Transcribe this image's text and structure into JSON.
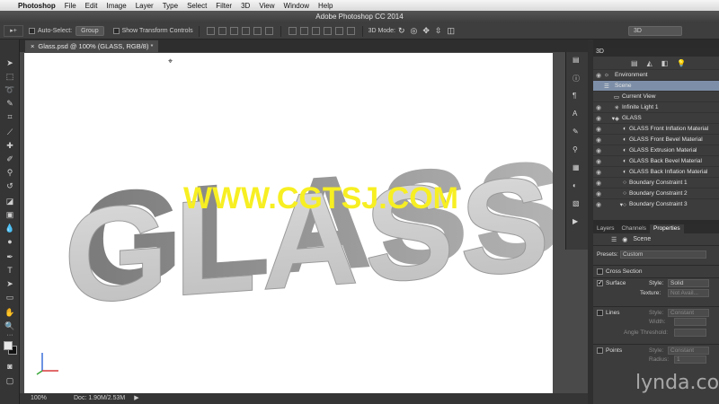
{
  "menubar": {
    "app_name": "Photoshop",
    "items": [
      "File",
      "Edit",
      "Image",
      "Layer",
      "Type",
      "Select",
      "Filter",
      "3D",
      "View",
      "Window",
      "Help"
    ]
  },
  "window_title": "Adobe Photoshop CC 2014",
  "options": {
    "auto_select_label": "Auto-Select:",
    "auto_select_value": "Group",
    "show_transform_label": "Show Transform Controls",
    "mode_label": "3D Mode:",
    "workspace_value": "3D"
  },
  "document": {
    "tab_title": "Glass.psd @ 100% (GLASS, RGB/8) *",
    "zoom": "100%",
    "doc_size": "Doc: 1.90M/2.53M",
    "scene_text": "GLASS"
  },
  "overlay_watermark": "WWW.CGTSJ.COM",
  "panel_3d": {
    "title": "3D",
    "rows": [
      {
        "label": "Environment",
        "icon": "environment-icon"
      },
      {
        "label": "Scene",
        "icon": "scene-icon"
      },
      {
        "label": "Current View",
        "icon": "camera-icon"
      },
      {
        "label": "Infinite Light 1",
        "icon": "light-icon"
      },
      {
        "label": "GLASS",
        "icon": "mesh-icon"
      },
      {
        "label": "GLASS Front Inflation Material",
        "icon": "material-icon"
      },
      {
        "label": "GLASS Front Bevel Material",
        "icon": "material-icon"
      },
      {
        "label": "GLASS Extrusion Material",
        "icon": "material-icon"
      },
      {
        "label": "GLASS Back Bevel Material",
        "icon": "material-icon"
      },
      {
        "label": "GLASS Back Inflation Material",
        "icon": "material-icon"
      },
      {
        "label": "Boundary Constraint 1",
        "icon": "constraint-icon"
      },
      {
        "label": "Boundary Constraint 2",
        "icon": "constraint-icon"
      },
      {
        "label": "Boundary Constraint 3",
        "icon": "constraint-icon"
      }
    ]
  },
  "properties_panel": {
    "tabs": [
      "Layers",
      "Channels",
      "Properties"
    ],
    "header": "Scene",
    "presets_label": "Presets:",
    "presets_value": "Custom",
    "cross_section_label": "Cross Section",
    "surface_label": "Surface",
    "surface_style_label": "Style:",
    "surface_style_value": "Solid",
    "texture_label": "Texture:",
    "texture_value": "Not Avail...",
    "lines_label": "Lines",
    "lines_style_label": "Style:",
    "lines_style_value": "Constant",
    "width_label": "Width:",
    "angle_label": "Angle Threshold:",
    "points_label": "Points",
    "points_style_label": "Style:",
    "points_style_value": "Constant",
    "radius_label": "Radius:",
    "radius_value": "1"
  },
  "brand_watermark": "lynda.com"
}
